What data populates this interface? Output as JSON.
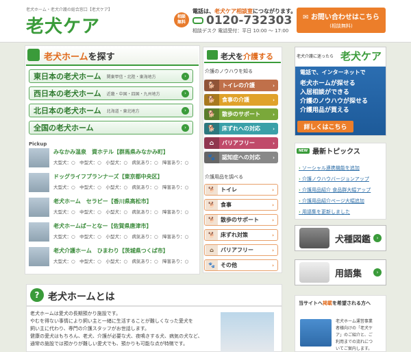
{
  "header": {
    "tagline": "老犬ホーム・老犬介護の総合窓口【老犬ケア】",
    "logo": "老犬ケア",
    "badge_line1": "相談",
    "badge_line2": "無料",
    "tel_note_pre": "電話は、",
    "tel_note_hl": "老犬ケア相談室",
    "tel_note_post": "につながります。",
    "tel_number": "0120-732303",
    "tel_hours": "相談デスク 電話受付：平日 10:00 ～ 17:00",
    "contact_main": "お問い合わせはこちら",
    "contact_sub": "(相談無料)"
  },
  "search": {
    "title_a": "老犬ホーム",
    "title_b": "を探す",
    "regions": [
      {
        "name": "東日本の老犬ホーム",
        "sub": "関東甲信・北陸・東海地方"
      },
      {
        "name": "西日本の老犬ホーム",
        "sub": "近畿・中国・四国・九州地方"
      },
      {
        "name": "北日本の老犬ホーム",
        "sub": "北海道・東北地方"
      },
      {
        "name": "全国の老犬ホーム",
        "sub": ""
      }
    ],
    "pickup_label": "Pickup",
    "pickups": [
      {
        "name": "みなかみ温泉　資ホテル【群馬県みなかみ町】",
        "spec": "大型犬：○　中型犬：○　小型犬：○　病気あり：○　障害あり：○"
      },
      {
        "name": "ドッグライフプランナーズ【東京都中央区】",
        "spec": "大型犬：○　中型犬：○　小型犬：○　病気あり：○　障害あり：○"
      },
      {
        "name": "老犬ホーム　セラピー【香川県高松市】",
        "spec": "大型犬：○　中型犬：○　小型犬：○　病気あり：○　障害あり：○"
      },
      {
        "name": "老犬ホームぱーとなー【佐賀県唐津市】",
        "spec": "大型犬：○　中型犬：○　小型犬：○　病気あり：○　障害あり：○"
      },
      {
        "name": "老犬介護ホーム　ひまわり【茨城県つくば市】",
        "spec": "大型犬：○　中型犬：○　小型犬：○　病気あり：○　障害あり：○"
      }
    ]
  },
  "care": {
    "title_a": "老犬を",
    "title_b": "介護する",
    "knowhow_label": "介護のノウハウを知る",
    "knowhow": [
      {
        "label": "トイレの介護",
        "color": "#c0704a",
        "icon": "toilet-icon"
      },
      {
        "label": "食事の介護",
        "color": "#e0a22a",
        "icon": "food-icon"
      },
      {
        "label": "散歩のサポート",
        "color": "#7aa83a",
        "icon": "walk-icon"
      },
      {
        "label": "床ずれへの対応",
        "color": "#3aa0a8",
        "icon": "bed-icon"
      },
      {
        "label": "バリアフリー",
        "color": "#c04a6a",
        "icon": "house-icon"
      },
      {
        "label": "認知症への対応",
        "color": "#888888",
        "icon": "paw-icon"
      }
    ],
    "goods_label": "介護用品を調べる",
    "goods": [
      {
        "label": "トイレ",
        "icon": "toilet-icon"
      },
      {
        "label": "食事",
        "icon": "food-icon"
      },
      {
        "label": "散歩のサポート",
        "icon": "walk-icon"
      },
      {
        "label": "床ずれ対策",
        "icon": "bed-icon"
      },
      {
        "label": "バリアフリー",
        "icon": "house-icon"
      },
      {
        "label": "その他",
        "icon": "paw-icon"
      }
    ]
  },
  "banner": {
    "head": "老犬介護に迷ったら",
    "logo": "老犬ケア",
    "lines": [
      "電話で、インターネットで",
      "老犬ホームが探せる",
      "入居相談ができる",
      "介護のノウハウが探せる",
      "介護用品が買える"
    ],
    "button": "詳しくはこちら"
  },
  "topics": {
    "new_tag": "NEW",
    "title": "最新トピックス",
    "items": [
      "ソーシャル連携機能を追加",
      "介護ノウハウバージョンアップ",
      "介護用品紹介 食品群大幅アップ",
      "介護用品紹介ページ大幅追加",
      "用語集を更新しました"
    ]
  },
  "guides": [
    {
      "label": "犬種図鑑"
    },
    {
      "label": "用語集"
    }
  ],
  "about": {
    "title": "老犬ホームとは",
    "lines": [
      "老犬ホームは愛犬の長期預かり施設です。",
      "やむを得ない事情により飼い主と一緒に生活することが難しくなった愛犬を",
      "飼い主に代わり、専門の介護スタッフがお世話します。",
      "健康の愛犬はもちろん、老犬、介護が必要な犬、夜鳴きする犬、病気の犬など、",
      "通常の施設では預かりが難しい愛犬でも、預かりも可能な点が特徴です。"
    ]
  },
  "ad": {
    "title_a": "当サイトへ",
    "title_b": "掲載",
    "title_c": "を希望される方へ",
    "lines": [
      "老犬ホーム運営事業",
      "者様向けの「老犬ケ",
      "ア」のご紹介と、ご",
      "利用までの流れにつ",
      "いてご案内します。"
    ]
  }
}
